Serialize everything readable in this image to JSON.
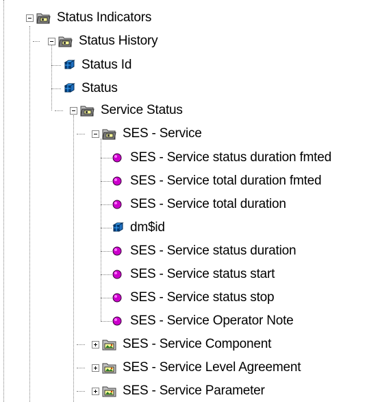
{
  "tree": {
    "nodes": [
      {
        "label": "Status Indicators",
        "icon": "folder-open-icon",
        "expanded": true
      },
      {
        "label": "Status History",
        "icon": "folder-open-icon",
        "expanded": true
      },
      {
        "label": "Status Id",
        "icon": "dimension-cube-icon"
      },
      {
        "label": "Status",
        "icon": "dimension-cube-icon"
      },
      {
        "label": "Service Status",
        "icon": "folder-open-icon",
        "expanded": true
      },
      {
        "label": "SES - Service",
        "icon": "folder-open-icon",
        "expanded": true
      },
      {
        "label": "SES - Service status duration fmted",
        "icon": "measure-dot-icon"
      },
      {
        "label": "SES - Service total duration fmted",
        "icon": "measure-dot-icon"
      },
      {
        "label": "SES - Service total duration",
        "icon": "measure-dot-icon"
      },
      {
        "label": "dm$id",
        "icon": "dimension-cube-icon"
      },
      {
        "label": "SES - Service status duration",
        "icon": "measure-dot-icon"
      },
      {
        "label": "SES - Service status start",
        "icon": "measure-dot-icon"
      },
      {
        "label": "SES - Service status stop",
        "icon": "measure-dot-icon"
      },
      {
        "label": "SES - Service Operator Note",
        "icon": "measure-dot-icon"
      },
      {
        "label": "SES - Service Component",
        "icon": "folder-closed-icon",
        "expanded": false
      },
      {
        "label": "SES - Service Level Agreement",
        "icon": "folder-closed-icon",
        "expanded": false
      },
      {
        "label": "SES - Service Parameter",
        "icon": "folder-closed-icon",
        "expanded": false
      }
    ]
  },
  "colors": {
    "folder_tab": "#808080",
    "folder_body": "#c0c0c0",
    "folder_inner": "#ffff99",
    "cube_dark": "#003f7f",
    "cube_light": "#3fa9ff",
    "measure_fill": "#cc00cc",
    "tree_line": "#808080"
  }
}
